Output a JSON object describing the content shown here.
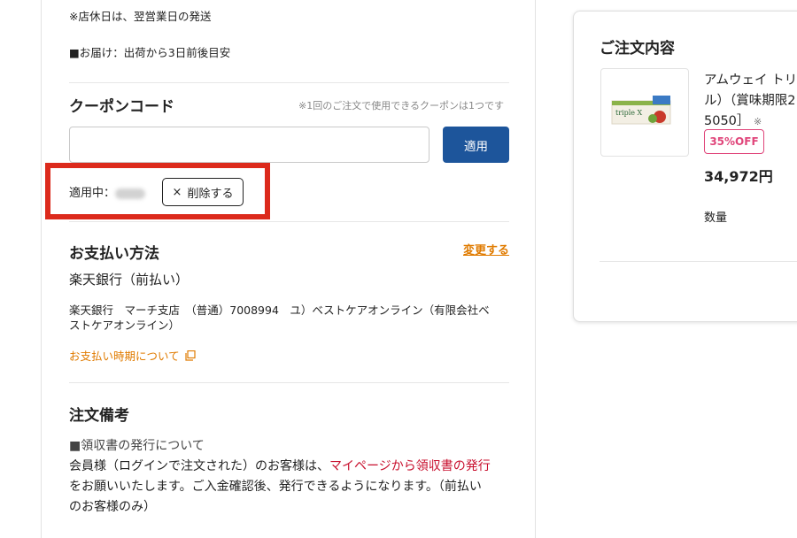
{
  "shipping": {
    "closed_day_note": "※店休日は、翌営業日の発送",
    "delivery_note": "■お届け：出荷から3日前後目安"
  },
  "coupon": {
    "title": "クーポンコード",
    "note": "※1回のご注文で使用できるクーポンは1つです",
    "input_value": "",
    "input_placeholder": "",
    "apply_label": "適用",
    "applied_label": "適用中：",
    "remove_label": "削除する"
  },
  "payment": {
    "title": "お支払い方法",
    "change_label": "変更する",
    "method": "楽天銀行（前払い）",
    "account_line1": "楽天銀行　マーチ支店　（普通）7008994　ユ）ベストケアオンライン（有限会社ベ",
    "account_line2": "ストケアオンライン）",
    "timing_link": "お支払い時期について"
  },
  "remarks": {
    "title": "注文備考",
    "line1": "■領収書の発行について",
    "line2_prefix": "会員様（ログインで注文された）のお客様は、",
    "line2_link": "マイページから領収書の発行",
    "line3": "をお願いいたします。ご入金確認後、発行できるようになります。（前払い",
    "line4": "のお客様のみ）"
  },
  "order_summary": {
    "title": "ご注文内容",
    "product_name_line1": "アムウェイ トリ",
    "product_name_line2": "ル）（賞味期限2",
    "product_name_line3": "5050］",
    "product_note_mark": "※",
    "product_image_text": "triple X",
    "discount_badge": "35%OFF",
    "price": "34,972円",
    "quantity_label": "数量"
  },
  "colors": {
    "primary_button": "#1d559b",
    "highlight_frame": "#dc2a1c",
    "link_orange": "#e07b00",
    "link_red": "#c8102e",
    "badge_pink": "#e0457a"
  }
}
